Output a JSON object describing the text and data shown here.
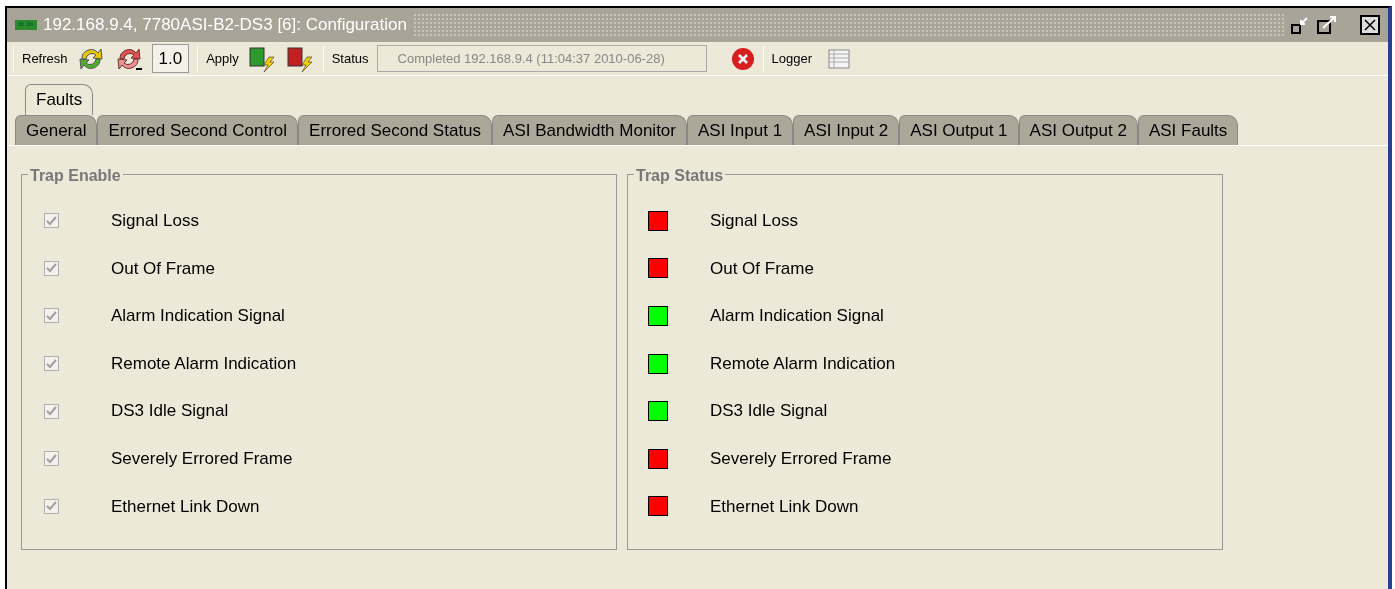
{
  "window": {
    "title": "192.168.9.4, 7780ASI-B2-DS3  [6]: Configuration"
  },
  "toolbar": {
    "refresh_label": "Refresh",
    "version": "1.0",
    "apply_label": "Apply",
    "status_label": "Status",
    "status_value": "Completed 192.168.9.4 (11:04:37  2010-06-28)",
    "logger_label": "Logger"
  },
  "tabs_top": [
    {
      "label": "Faults",
      "selected": true
    }
  ],
  "tabs_bottom": [
    {
      "label": "General",
      "selected": false
    },
    {
      "label": "Errored Second Control",
      "selected": false
    },
    {
      "label": "Errored Second Status",
      "selected": false
    },
    {
      "label": "ASI Bandwidth Monitor",
      "selected": false
    },
    {
      "label": "ASI Input 1",
      "selected": false
    },
    {
      "label": "ASI Input 2",
      "selected": false
    },
    {
      "label": "ASI Output 1",
      "selected": false
    },
    {
      "label": "ASI Output 2",
      "selected": false
    },
    {
      "label": "ASI Faults",
      "selected": false
    }
  ],
  "trap_enable": {
    "title": "Trap Enable",
    "items": [
      {
        "label": "Signal Loss",
        "checked": true,
        "disabled": true
      },
      {
        "label": "Out Of Frame",
        "checked": true,
        "disabled": true
      },
      {
        "label": "Alarm Indication Signal",
        "checked": true,
        "disabled": true
      },
      {
        "label": "Remote Alarm Indication",
        "checked": true,
        "disabled": true
      },
      {
        "label": "DS3 Idle Signal",
        "checked": true,
        "disabled": true
      },
      {
        "label": "Severely Errored Frame",
        "checked": true,
        "disabled": true
      },
      {
        "label": "Ethernet Link Down",
        "checked": true,
        "disabled": true
      }
    ]
  },
  "trap_status": {
    "title": "Trap Status",
    "items": [
      {
        "label": "Signal Loss",
        "color": "#ff0000"
      },
      {
        "label": "Out Of Frame",
        "color": "#ff0000"
      },
      {
        "label": "Alarm Indication Signal",
        "color": "#00ff00"
      },
      {
        "label": "Remote Alarm Indication",
        "color": "#00ff00"
      },
      {
        "label": "DS3 Idle Signal",
        "color": "#00ff00"
      },
      {
        "label": "Severely Errored Frame",
        "color": "#ff0000"
      },
      {
        "label": "Ethernet Link Down",
        "color": "#ff0000"
      }
    ]
  }
}
